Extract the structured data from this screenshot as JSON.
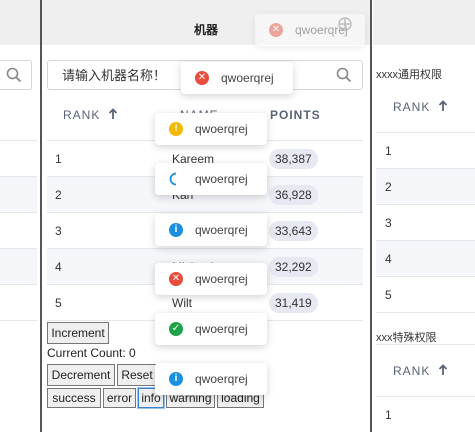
{
  "window": {
    "title": "机器"
  },
  "main": {
    "search_placeholder": "请输入机器名称！",
    "columns": {
      "rank": "RANK",
      "name": "NAME",
      "points": "POINTS"
    },
    "rows": [
      {
        "rank": "1",
        "name": "Kareem",
        "points": "38,387"
      },
      {
        "rank": "2",
        "name": "Kari",
        "points": "36,928"
      },
      {
        "rank": "3",
        "name": "",
        "points": "33,643"
      },
      {
        "rank": "4",
        "name": "Michael",
        "points": "32,292"
      },
      {
        "rank": "5",
        "name": "Wilt",
        "points": "31,419"
      }
    ]
  },
  "controls": {
    "increment": "Increment",
    "count_label": "Current Count: 0",
    "decrement": "Decrement",
    "reset": "Reset",
    "success": "success",
    "error": "error",
    "info": "info",
    "warning": "warning",
    "loading": "loading"
  },
  "right_panel": {
    "section1_title": "xxxx通用权限",
    "section1_rank": "RANK",
    "section1_rows": [
      "1",
      "2",
      "3",
      "4",
      "5"
    ],
    "section2_title": "xxx特殊权限",
    "section2_rank": "RANK",
    "section2_rows": [
      "1"
    ]
  },
  "toasts": [
    {
      "type": "error",
      "text": "qwoerqrej"
    },
    {
      "type": "error",
      "text": "qwoerqrej"
    },
    {
      "type": "warning",
      "text": "qwoerqrej"
    },
    {
      "type": "loading",
      "text": "qwoerqrej"
    },
    {
      "type": "info",
      "text": "qwoerqrej"
    },
    {
      "type": "error",
      "text": "qwoerqrej"
    },
    {
      "type": "success",
      "text": "qwoerqrej"
    },
    {
      "type": "info",
      "text": "qwoerqrej"
    }
  ],
  "colors": {
    "error": "#e74c3c",
    "warning": "#f5b800",
    "info": "#1a90e0",
    "success": "#1fa24a",
    "loading": "#1a90e0"
  }
}
